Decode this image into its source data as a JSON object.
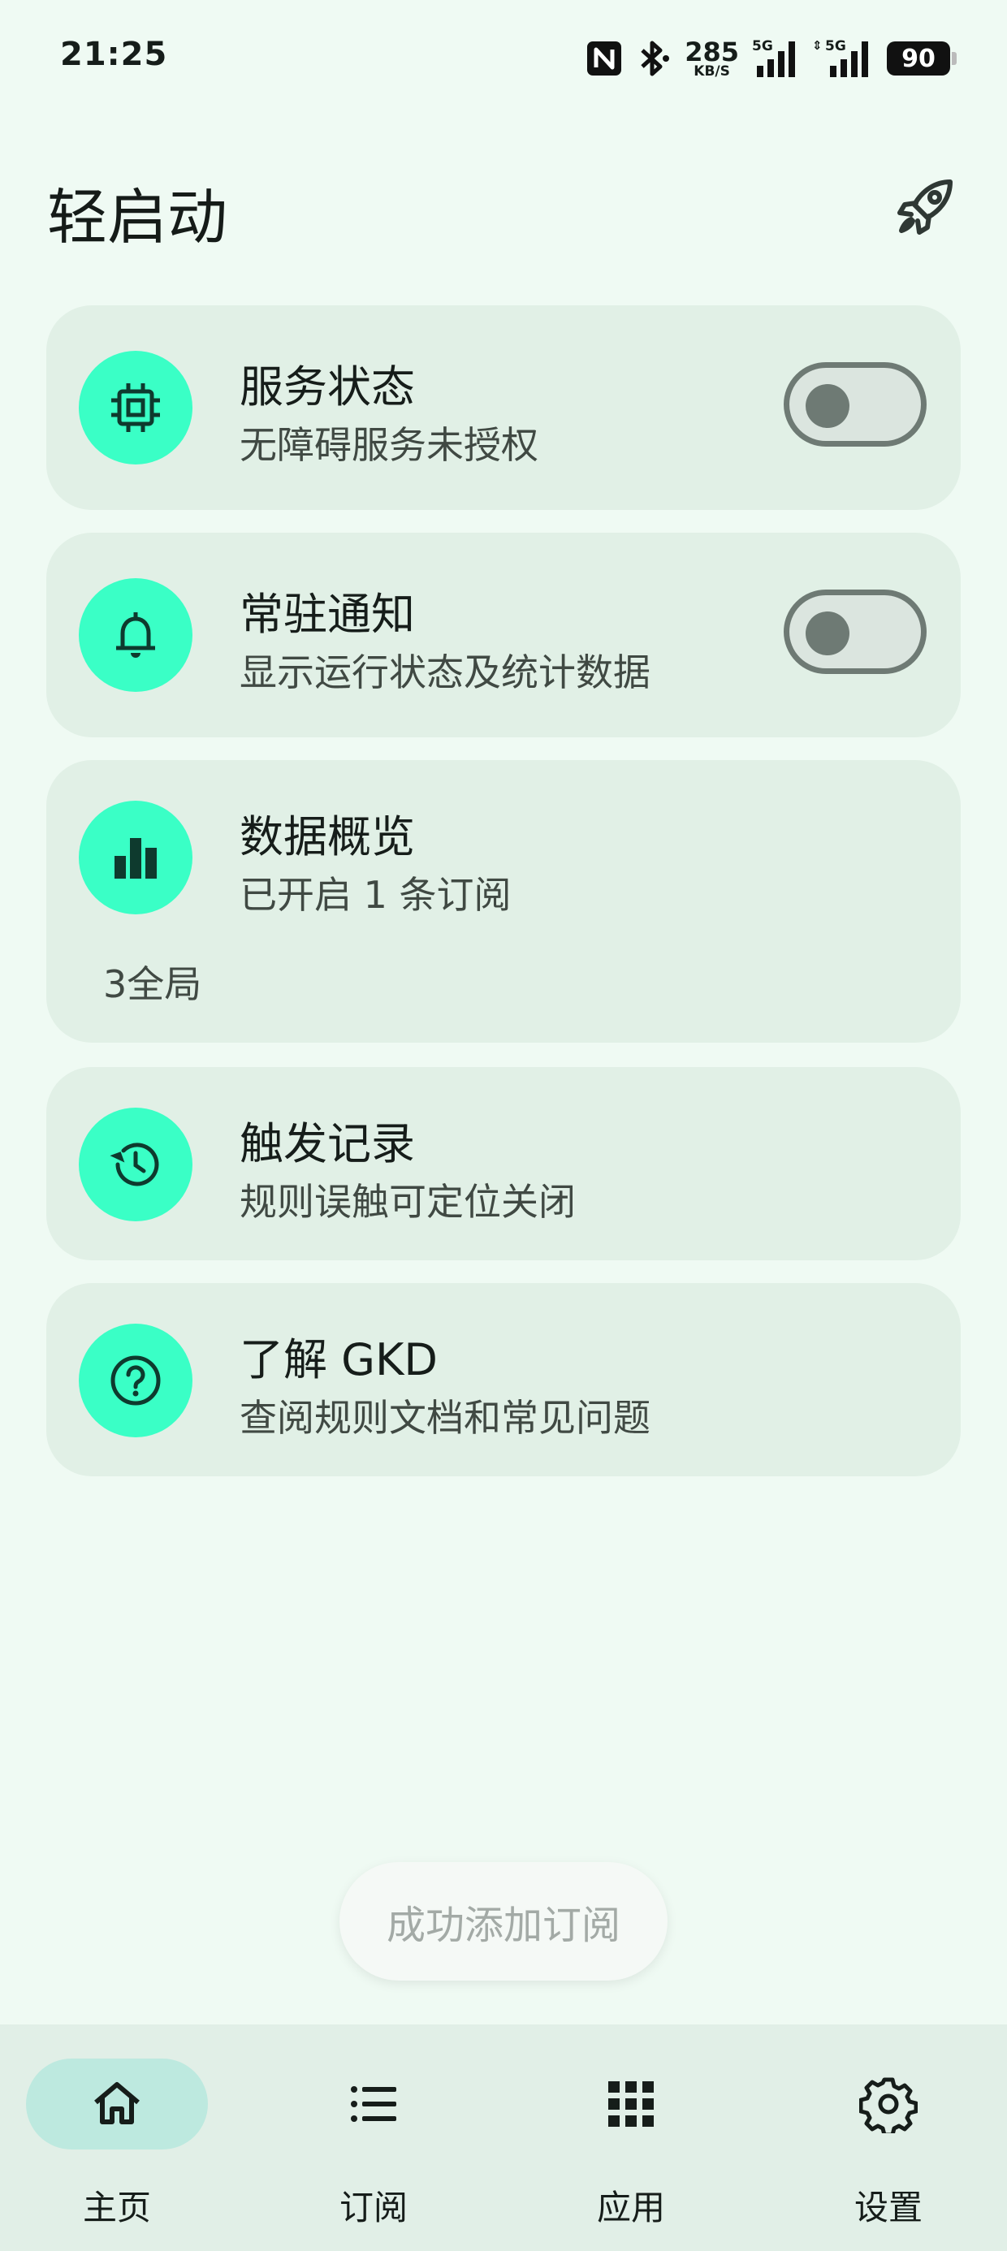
{
  "status_bar": {
    "time": "21:25",
    "net_speed_value": "285",
    "net_speed_unit": "KB/S",
    "signal_1_label": "5G",
    "signal_2_label": "5G",
    "battery": "90",
    "icons": [
      "nfc-icon",
      "bluetooth-icon",
      "signal-icon",
      "signal-icon"
    ]
  },
  "header": {
    "title": "轻启动",
    "action_icon": "rocket-icon"
  },
  "cards": {
    "service": {
      "title": "服务状态",
      "subtitle": "无障碍服务未授权",
      "icon": "chip-icon",
      "toggle_on": false
    },
    "notification": {
      "title": "常驻通知",
      "subtitle": "显示运行状态及统计数据",
      "icon": "bell-icon",
      "toggle_on": false
    },
    "overview": {
      "title": "数据概览",
      "subtitle": "已开启 1 条订阅",
      "extra": "3全局",
      "icon": "bar-chart-icon"
    },
    "history": {
      "title": "触发记录",
      "subtitle": "规则误触可定位关闭",
      "icon": "history-icon"
    },
    "about": {
      "title": "了解 GKD",
      "subtitle": "查阅规则文档和常见问题",
      "icon": "help-icon"
    }
  },
  "toast": {
    "text": "成功添加订阅"
  },
  "bottom_nav": {
    "items": [
      {
        "label": "主页",
        "icon": "home-icon",
        "active": true
      },
      {
        "label": "订阅",
        "icon": "list-icon",
        "active": false
      },
      {
        "label": "应用",
        "icon": "apps-grid-icon",
        "active": false
      },
      {
        "label": "设置",
        "icon": "gear-icon",
        "active": false
      }
    ]
  },
  "colors": {
    "background": "#effaf3",
    "card": "#e1f0e6",
    "icon_circle": "#3affc6",
    "nav_active": "#bde9df"
  }
}
